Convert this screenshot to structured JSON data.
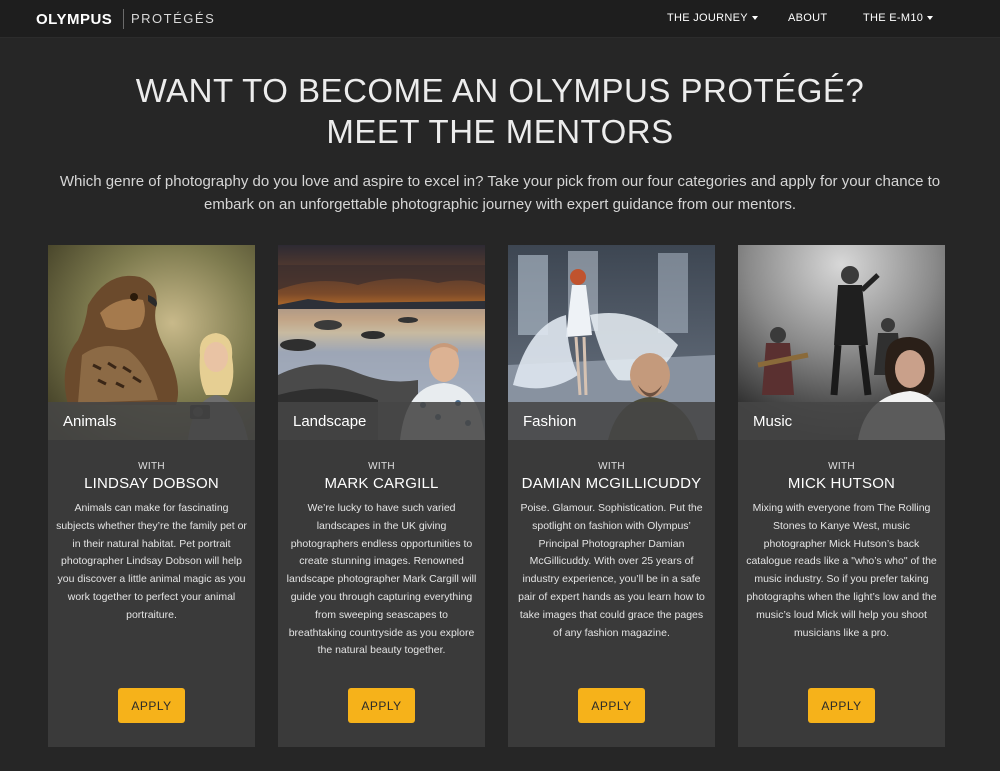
{
  "nav": {
    "logo": "OLYMPUS",
    "logo_sub": "PROTÉGÉS",
    "items": [
      {
        "label": "THE JOURNEY",
        "has_caret": true
      },
      {
        "label": "ABOUT",
        "has_caret": false
      },
      {
        "label": "THE E-M10",
        "has_caret": true
      }
    ]
  },
  "hero": {
    "title_line1": "WANT TO BECOME AN OLYMPUS PROTÉGÉ?",
    "title_line2": "MEET THE MENTORS",
    "intro": "Which genre of photography do you love and aspire to excel in? Take your pick from our four categories and apply for your chance to embark on an unforgettable photographic journey with expert guidance from our mentors."
  },
  "cards": [
    {
      "category": "Animals",
      "with": "WITH",
      "mentor": "LINDSAY DOBSON",
      "description": "Animals can make for fascinating subjects whether they’re the family pet or in their natural habitat. Pet portrait photographer Lindsay Dobson will help you discover a little animal magic as you work together to perfect your animal portraiture.",
      "apply": "APPLY"
    },
    {
      "category": "Landscape",
      "with": "WITH",
      "mentor": "MARK CARGILL",
      "description": "We’re lucky to have such varied landscapes in the UK giving photographers endless opportunities to create stunning images. Renowned landscape photographer Mark Cargill will guide you through capturing everything from sweeping seascapes to breathtaking countryside as you explore the natural beauty together.",
      "apply": "APPLY"
    },
    {
      "category": "Fashion",
      "with": "WITH",
      "mentor": "DAMIAN MCGILLICUDDY",
      "description": "Poise. Glamour. Sophistication. Put the spotlight on fashion with Olympus’ Principal Photographer Damian McGillicuddy. With over 25 years of industry experience, you’ll be in a safe pair of expert hands as you learn how to take images that could grace the pages of any fashion magazine.",
      "apply": "APPLY"
    },
    {
      "category": "Music",
      "with": "WITH",
      "mentor": "MICK HUTSON",
      "description": "Mixing with everyone from The Rolling Stones to Kanye West, music photographer Mick Hutson’s back catalogue reads like a \"who’s who\" of the music industry. So if you prefer taking photographs when the light’s low and the music’s loud Mick will help you shoot musicians like a pro.",
      "apply": "APPLY"
    }
  ],
  "colors": {
    "background": "#262626",
    "card": "#3a3a3a",
    "accent": "#f6b21a"
  }
}
